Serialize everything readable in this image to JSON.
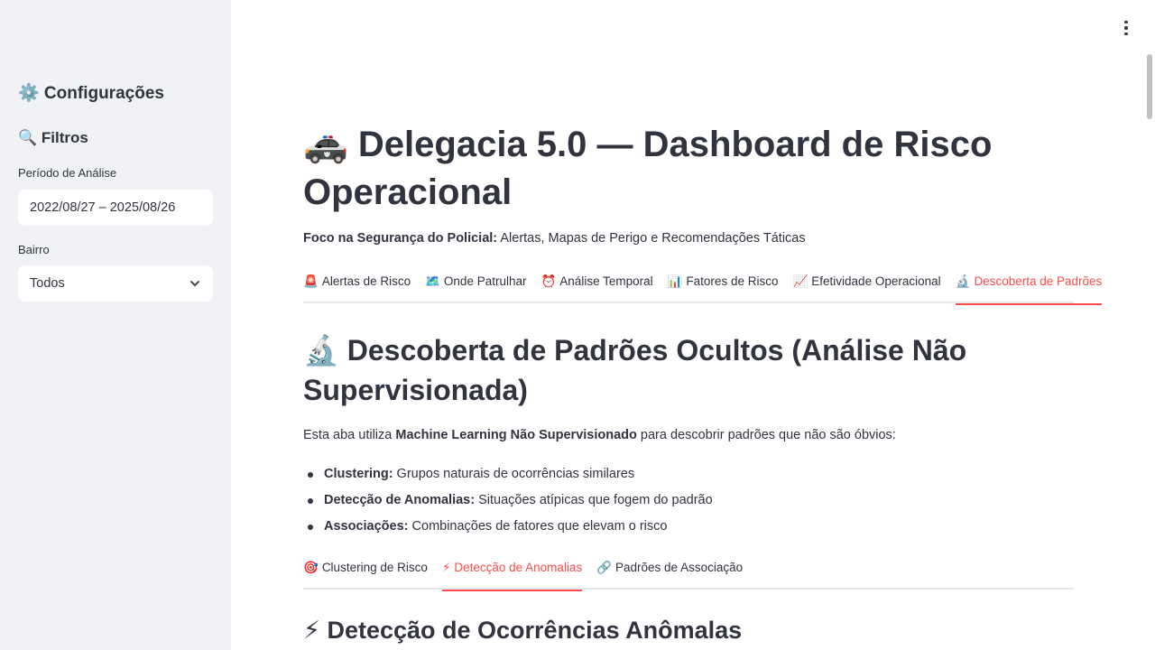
{
  "sidebar": {
    "settings_heading": "⚙️ Configurações",
    "filters_heading": "🔍 Filtros",
    "period_label": "Período de Análise",
    "period_value": "2022/08/27 – 2025/08/26",
    "neighborhood_label": "Bairro",
    "neighborhood_value": "Todos"
  },
  "main": {
    "title": "🚓 Delegacia 5.0 — Dashboard de Risco Operacional",
    "subtitle_bold": "Foco na Segurança do Policial:",
    "subtitle_rest": " Alertas, Mapas de Perigo e Recomendações Táticas",
    "tabs": [
      {
        "icon": "🚨",
        "label": "Alertas de Risco"
      },
      {
        "icon": "🗺️",
        "label": "Onde Patrulhar"
      },
      {
        "icon": "⏰",
        "label": "Análise Temporal"
      },
      {
        "icon": "📊",
        "label": "Fatores de Risco"
      },
      {
        "icon": "📈",
        "label": "Efetividade Operacional"
      },
      {
        "icon": "🔬",
        "label": "Descoberta de Padrões"
      }
    ],
    "section_title": "🔬 Descoberta de Padrões Ocultos (Análise Não Supervisionada)",
    "intro_prefix": "Esta aba utiliza ",
    "intro_bold": "Machine Learning Não Supervisionado",
    "intro_suffix": " para descobrir padrões que não são óbvios:",
    "bullets": [
      {
        "bold": "Clustering:",
        "text": " Grupos naturais de ocorrências similares"
      },
      {
        "bold": "Detecção de Anomalias:",
        "text": " Situações atípicas que fogem do padrão"
      },
      {
        "bold": "Associações:",
        "text": " Combinações de fatores que elevam o risco"
      }
    ],
    "subtabs": [
      {
        "icon": "🎯",
        "label": "Clustering de Risco"
      },
      {
        "icon": "⚡",
        "label": "Detecção de Anomalias"
      },
      {
        "icon": "🔗",
        "label": "Padrões de Associação"
      }
    ],
    "subsection_title": "⚡ Detecção de Ocorrências Anômalas"
  },
  "colors": {
    "accent": "#ff4b4b",
    "sidebar_bg": "#f0f2f6",
    "text": "#31333f"
  }
}
